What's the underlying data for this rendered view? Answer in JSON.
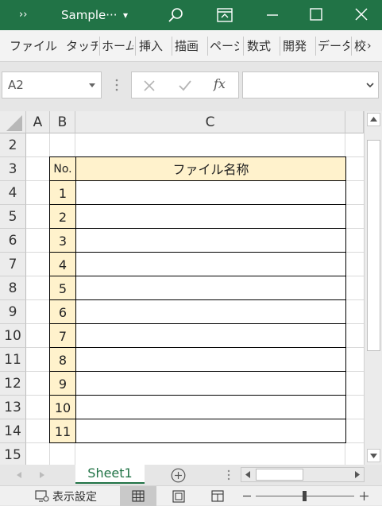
{
  "title_bar": {
    "more_glyph": "››",
    "doc_name": "Sample···",
    "dropdown_glyph": "▾"
  },
  "ribbon_tabs": [
    "ファイル",
    "タッチ",
    "ホーム",
    "挿入",
    "描画",
    "ページ",
    "数式",
    "開発",
    "データ",
    "校"
  ],
  "ribbon_more": "›",
  "name_box": {
    "value": "A2"
  },
  "formula_bar": {
    "fx_label": "fx",
    "value": ""
  },
  "columns": [
    "A",
    "B",
    "C"
  ],
  "rows": [
    "2",
    "3",
    "4",
    "5",
    "6",
    "7",
    "8",
    "9",
    "10",
    "11",
    "12",
    "13",
    "14",
    "15"
  ],
  "table": {
    "header_no": "No.",
    "header_name": "ファイル名称",
    "numbers": [
      "1",
      "2",
      "3",
      "4",
      "5",
      "6",
      "7",
      "8",
      "9",
      "10",
      "11"
    ],
    "header_fill": "#fff2cc"
  },
  "sheet_tabs": [
    {
      "label": "Sheet1",
      "active": true
    }
  ],
  "status": {
    "display_settings": "表示設定"
  },
  "colors": {
    "accent": "#217346"
  }
}
